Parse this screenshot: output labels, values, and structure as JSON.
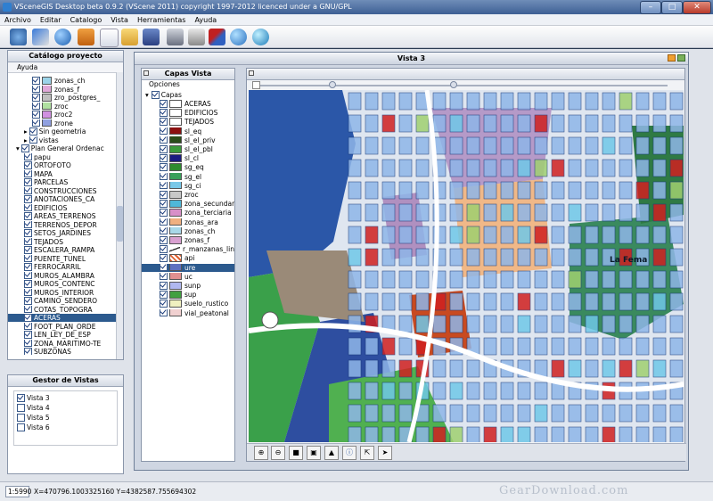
{
  "window": {
    "title": "VSceneGIS Desktop  beta 0.9.2    (VScene 2011) copyright 1997-2012 licenced under a GNU/GPL"
  },
  "menu": [
    "Archivo",
    "Editar",
    "Catalogo",
    "Vista",
    "Herramientas",
    "Ayuda"
  ],
  "toolbar_icons": [
    "info-icon",
    "network-icon",
    "globe-icon",
    "monitor-icon",
    "new-file-icon",
    "open-folder-icon",
    "save-icon",
    "print-icon",
    "server-icon",
    "tools-icon",
    "globe-search-icon",
    "add-layer-icon"
  ],
  "catalog": {
    "title": "Catálogo proyecto",
    "menu": "Ayuda",
    "rows": [
      {
        "label": "zonas_ch",
        "swatch": "#9bd3e8",
        "indent": 3
      },
      {
        "label": "zonas_f",
        "swatch": "#e0a8d8",
        "indent": 3
      },
      {
        "label": "zro_postgres_",
        "swatch": "#c0c0c0",
        "indent": 3
      },
      {
        "label": "zroc",
        "swatch": "#b0e0a0",
        "indent": 3
      },
      {
        "label": "zroc2",
        "swatch": "#d090e0",
        "indent": 3
      },
      {
        "label": "zrone",
        "swatch": "#90a0e0",
        "indent": 3
      },
      {
        "label": "Sin geometria",
        "indent": 2,
        "expander": "▸"
      },
      {
        "label": "vistas",
        "indent": 2,
        "expander": "▸"
      },
      {
        "label": "Plan General Ordenac",
        "indent": 1,
        "expander": "▾"
      },
      {
        "label": "papu",
        "indent": 2
      },
      {
        "label": "ORTOFOTO",
        "indent": 2
      },
      {
        "label": "MAPA",
        "indent": 2
      },
      {
        "label": "PARCELAS",
        "indent": 2
      },
      {
        "label": "CONSTRUCCIONES",
        "indent": 2
      },
      {
        "label": "ANOTACIONES_CA",
        "indent": 2
      },
      {
        "label": "EDIFICIOS",
        "indent": 2
      },
      {
        "label": "AREAS_TERRENOS",
        "indent": 2
      },
      {
        "label": "TERRENOS_DEPOR",
        "indent": 2
      },
      {
        "label": "SETOS_JARDINES",
        "indent": 2
      },
      {
        "label": "TEJADOS",
        "indent": 2
      },
      {
        "label": "ESCALERA_RAMPA",
        "indent": 2
      },
      {
        "label": "PUENTE_TUNEL",
        "indent": 2
      },
      {
        "label": "FERROCARRIL",
        "indent": 2
      },
      {
        "label": "MUROS_ALAMBRA",
        "indent": 2
      },
      {
        "label": "MUROS_CONTENC",
        "indent": 2
      },
      {
        "label": "MUROS_INTERIOR",
        "indent": 2
      },
      {
        "label": "CAMINO_SENDERO",
        "indent": 2
      },
      {
        "label": "COTAS_TOPOGRA",
        "indent": 2
      },
      {
        "label": "ACERAS",
        "indent": 2,
        "selected": true
      },
      {
        "label": "FOOT_PLAN_ORDE",
        "indent": 2
      },
      {
        "label": "LEN_LEY_DE_ESP",
        "indent": 2
      },
      {
        "label": "ZONA_MARITIMO-TE",
        "indent": 2
      },
      {
        "label": "SUBZONAS",
        "indent": 2
      }
    ]
  },
  "views_manager": {
    "title": "Gestor de Vistas",
    "items": [
      {
        "label": "Vista 3",
        "checked": true
      },
      {
        "label": "Vista 4",
        "checked": false
      },
      {
        "label": "Vista 5",
        "checked": false
      },
      {
        "label": "Vista 6",
        "checked": false
      }
    ]
  },
  "view": {
    "title": "Vista 3"
  },
  "layers_panel": {
    "title": "Capas Vista",
    "options_label": "Opciones",
    "root_label": "Capas",
    "layers": [
      {
        "label": "ACERAS",
        "swatch": "#ffffff"
      },
      {
        "label": "EDIFICIOS",
        "swatch": "#ffffff"
      },
      {
        "label": "TEJADOS",
        "swatch": "#ffffff"
      },
      {
        "label": "sl_eq",
        "swatch": "#8b1010"
      },
      {
        "label": "sl_el_priv",
        "swatch": "#2a4d1a"
      },
      {
        "label": "sl_el_pbl",
        "swatch": "#3b9a3b"
      },
      {
        "label": "sl_cl",
        "swatch": "#1a1a80"
      },
      {
        "label": "sg_eq",
        "swatch": "#2e8b2e"
      },
      {
        "label": "sg_el",
        "swatch": "#3aa05a"
      },
      {
        "label": "sg_ci",
        "swatch": "#78c8e8"
      },
      {
        "label": "zroc",
        "swatch": "#c8c8c8"
      },
      {
        "label": "zona_secundaria",
        "swatch": "#4fb8d8"
      },
      {
        "label": "zona_terciaria",
        "swatch": "#d890c8"
      },
      {
        "label": "zonas_ara",
        "swatch": "#f0b080"
      },
      {
        "label": "zonas_ch",
        "swatch": "#a8d8e8"
      },
      {
        "label": "zonas_f",
        "swatch": "#d8a0d0"
      },
      {
        "label": "r_manzanas_lines",
        "swatch": "#ffffff",
        "line": true
      },
      {
        "label": "api",
        "swatch": "#e06030",
        "hatch": true
      },
      {
        "label": "ure",
        "swatch": "#6070c0",
        "selected": true
      },
      {
        "label": "uc",
        "swatch": "#e09090"
      },
      {
        "label": "sunp",
        "swatch": "#b0b8f0"
      },
      {
        "label": "sup",
        "swatch": "#40a040"
      },
      {
        "label": "suelo_rustico",
        "swatch": "#f0f0c0"
      },
      {
        "label": "vial_peatonal",
        "swatch": "#f0d0d0"
      }
    ]
  },
  "map": {
    "label": "La Fema",
    "toolbar": [
      "zoom-in-icon",
      "zoom-out-icon",
      "full-extent-icon",
      "zoom-box-icon",
      "image-icon",
      "info-icon",
      "select-icon",
      "pointer-icon"
    ]
  },
  "status": {
    "scale": "1:5990",
    "coords": "X=470796.1003325160  Y=4382587.755694302"
  },
  "watermark": "GearDownload.com"
}
